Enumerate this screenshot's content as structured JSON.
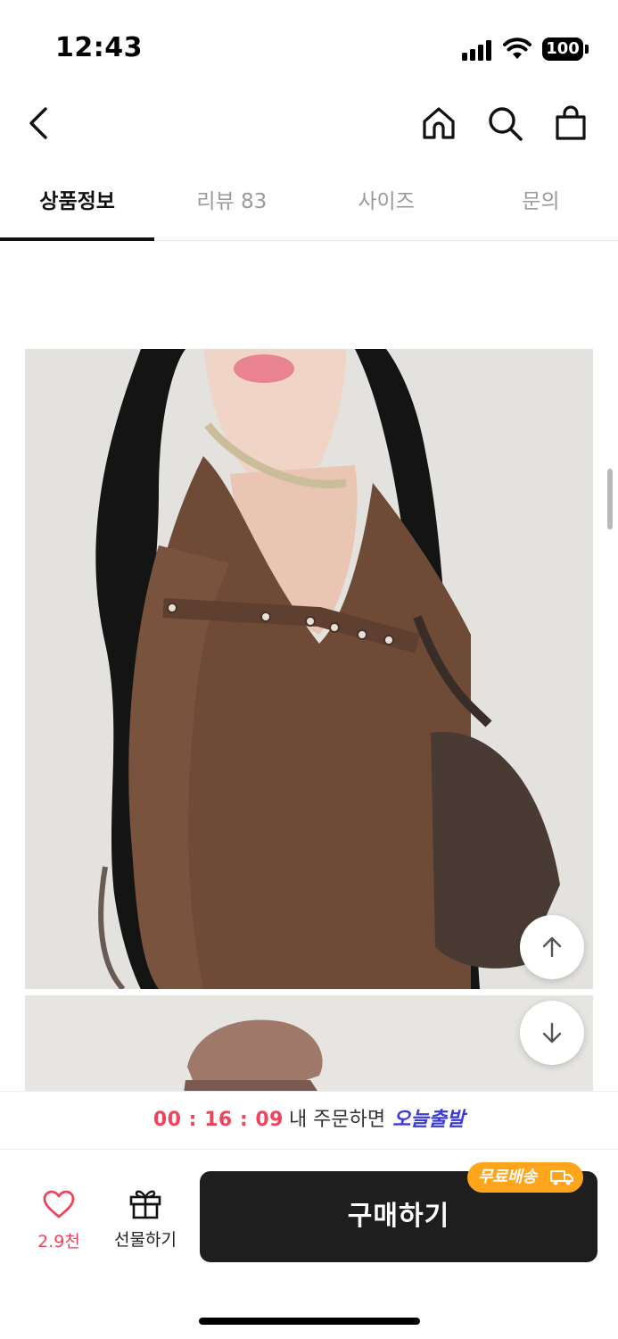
{
  "status_bar": {
    "time": "12:43",
    "battery": "100"
  },
  "header": {
    "back": "back-arrow-icon",
    "home": "home-icon",
    "search": "search-icon",
    "cart": "shopping-bag-icon"
  },
  "tabs": [
    {
      "label": "상품정보",
      "active": true
    },
    {
      "label": "리뷰 83",
      "active": false
    },
    {
      "label": "사이즈",
      "active": false
    },
    {
      "label": "문의",
      "active": false
    }
  ],
  "timer": {
    "value": "00 : 16 : 09",
    "text": "내 주문하면",
    "brand": "오늘출발"
  },
  "bottom": {
    "like_count": "2.9천",
    "gift_label": "선물하기",
    "buy_label": "구매하기",
    "free_shipping": "무료배송"
  },
  "colors": {
    "accent_red": "#f0445c",
    "brand_blue": "#3a3ad6",
    "badge_orange": "#ffa51c",
    "buy_button": "#1e1e1e"
  }
}
